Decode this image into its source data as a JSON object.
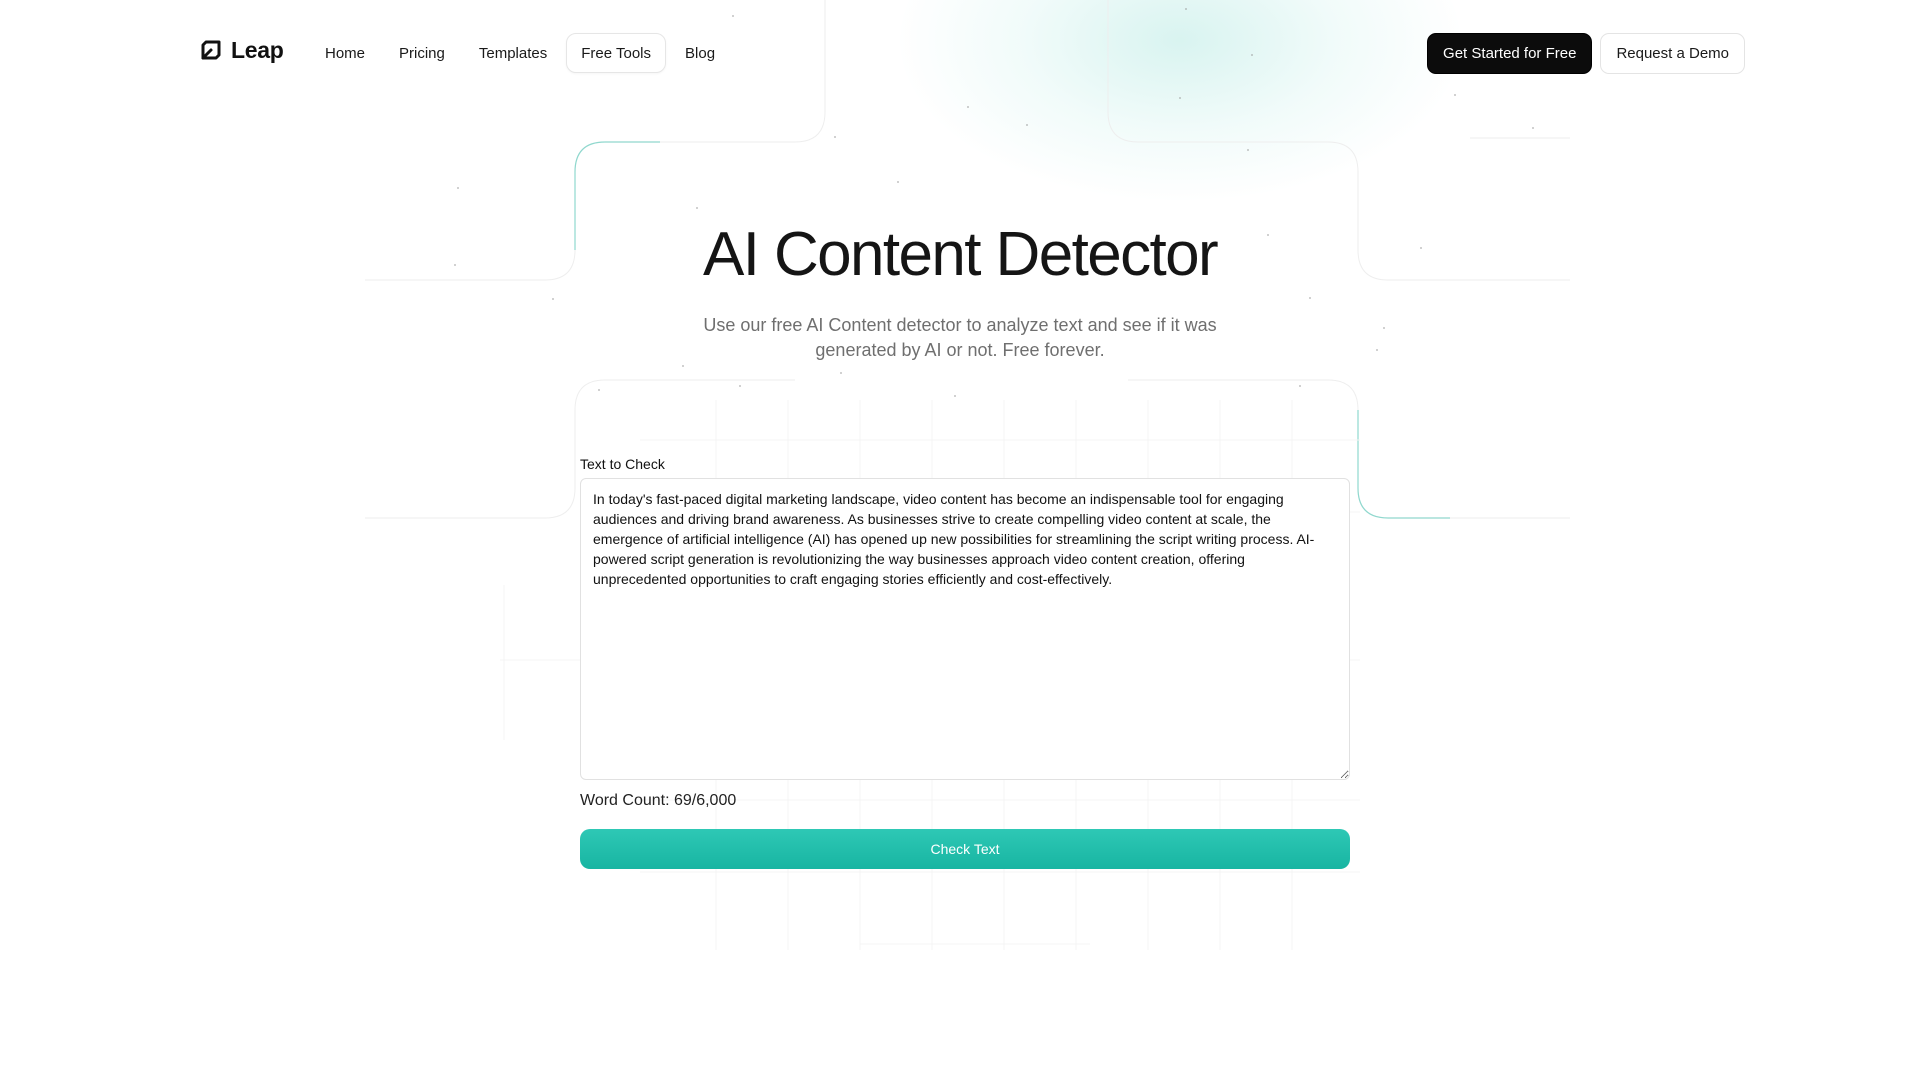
{
  "header": {
    "logo_text": "Leap",
    "nav": [
      {
        "label": "Home"
      },
      {
        "label": "Pricing"
      },
      {
        "label": "Templates"
      },
      {
        "label": "Free Tools",
        "active": true
      },
      {
        "label": "Blog"
      }
    ],
    "cta_primary": "Get Started for Free",
    "cta_secondary": "Request a Demo"
  },
  "hero": {
    "title": "AI Content Detector",
    "subtitle": "Use our free AI Content detector to analyze text and see if it was generated by AI or not. Free forever."
  },
  "form": {
    "label": "Text to Check",
    "text_value": "In today's fast-paced digital marketing landscape, video content has become an indispensable tool for engaging audiences and driving brand awareness. As businesses strive to create compelling video content at scale, the emergence of artificial intelligence (AI) has opened up new possibilities for streamlining the script writing process. AI-powered script generation is revolutionizing the way businesses approach video content creation, offering unprecedented opportunities to craft engaging stories efficiently and cost-effectively.",
    "word_count": "Word Count: 69/6,000",
    "submit_label": "Check Text"
  },
  "colors": {
    "accent": "#1fbfab",
    "primary_button": "#0c0c0c",
    "text": "#151515",
    "muted_text": "#6f6f6f"
  },
  "icons": {
    "logo": "leap-logo-icon"
  }
}
